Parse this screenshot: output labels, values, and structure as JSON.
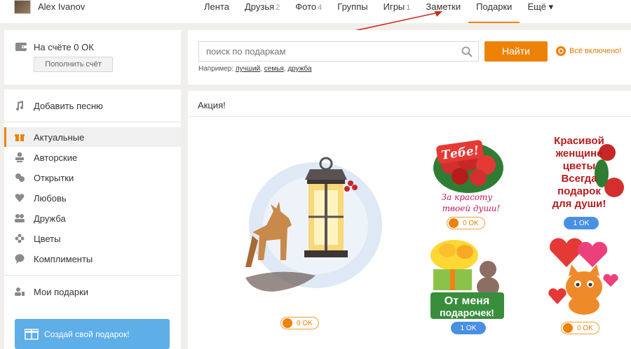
{
  "user": {
    "name": "Alex Ivanov"
  },
  "topnav": [
    {
      "label": "Лента",
      "count": ""
    },
    {
      "label": "Друзья",
      "count": "2"
    },
    {
      "label": "Фото",
      "count": "4"
    },
    {
      "label": "Группы",
      "count": ""
    },
    {
      "label": "Игры",
      "count": "1"
    },
    {
      "label": "Заметки",
      "count": ""
    },
    {
      "label": "Подарки",
      "count": ""
    },
    {
      "label": "Ещё ▾",
      "count": ""
    }
  ],
  "balance": {
    "text": "На счёте 0 ОК",
    "button": "Пополнить счёт"
  },
  "menu": {
    "add_song": "Добавить песню",
    "categories": [
      "Актуальные",
      "Авторские",
      "Открытки",
      "Любовь",
      "Дружба",
      "Цветы",
      "Комплименты"
    ],
    "my_gifts": "Мои подарки",
    "create": "Создай свой подарок!"
  },
  "search": {
    "placeholder": "поиск по подаркам",
    "button": "Найти",
    "all_included": "Всё включено!",
    "example_label": "Например:",
    "examples": [
      "лучший",
      "семья",
      "дружба"
    ]
  },
  "promo": {
    "title": "Акция!",
    "gifts": [
      {
        "name": "lantern-deer",
        "price": "0 OK"
      },
      {
        "name": "tebe-roses",
        "caption": "Тебе! За красоту твоей души!",
        "price": "0 OK"
      },
      {
        "name": "krasivoy-zhenshchine",
        "caption": "Красивой женщине цветы Всегда подарок для души!",
        "price": "1 OK"
      },
      {
        "name": "ot-menya-podarochek",
        "caption": "От меня подарочек!",
        "price": "1 OK"
      },
      {
        "name": "kitten-hearts",
        "price": "0 OK"
      }
    ]
  },
  "colors": {
    "accent": "#ee8208",
    "blue": "#4a90e2",
    "create_btn": "#5eaee8"
  }
}
